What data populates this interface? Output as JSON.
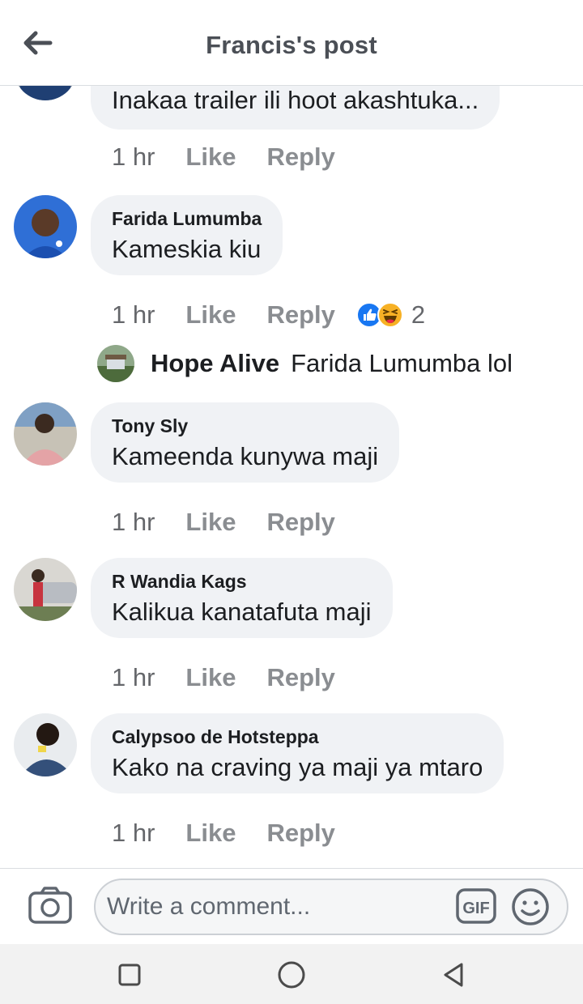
{
  "header": {
    "title": "Francis's post"
  },
  "comments": [
    {
      "name": "",
      "text": "Inakaa trailer ili hoot akashtuka...",
      "time": "1 hr",
      "like": "Like",
      "reply": "Reply"
    },
    {
      "name": "Farida Lumumba",
      "text": "Kameskia kiu",
      "time": "1 hr",
      "like": "Like",
      "reply": "Reply",
      "reaction_count": "2"
    },
    {
      "name": "Tony Sly",
      "text": "Kameenda kunywa maji",
      "time": "1 hr",
      "like": "Like",
      "reply": "Reply"
    },
    {
      "name": "R Wandia Kags",
      "text": "Kalikua kanatafuta maji",
      "time": "1 hr",
      "like": "Like",
      "reply": "Reply"
    },
    {
      "name": "Calypsoo de Hotsteppa",
      "text": "Kako na craving ya maji ya mtaro",
      "time": "1 hr",
      "like": "Like",
      "reply": "Reply"
    }
  ],
  "reply_preview": {
    "name": "Hope Alive",
    "text": "Farida Lumumba lol"
  },
  "composer": {
    "placeholder": "Write a comment...",
    "gif_label": "GIF"
  },
  "icons": [
    "back-arrow-icon",
    "like-reaction-icon",
    "haha-reaction-icon",
    "camera-icon",
    "gif-icon",
    "emoji-icon",
    "recent-apps-icon",
    "home-icon",
    "back-nav-icon"
  ],
  "colors": {
    "bubble": "#f0f2f5",
    "like_blue": "#1877f2",
    "haha_yellow": "#f7b125",
    "muted_text": "#65676b"
  }
}
